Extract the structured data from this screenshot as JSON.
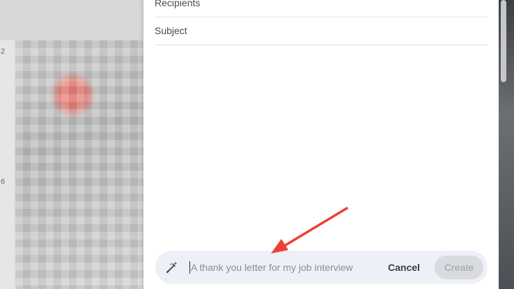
{
  "compose": {
    "recipients_label": "Recipients",
    "subject_label": "Subject"
  },
  "help_me_write": {
    "icon": "pen-sparkle-icon",
    "placeholder": "A thank you letter for my job interview",
    "cancel_label": "Cancel",
    "create_label": "Create"
  },
  "annotation": {
    "arrow_color": "#ee4035"
  },
  "sidebar": {
    "marks": [
      "2",
      "6"
    ]
  }
}
